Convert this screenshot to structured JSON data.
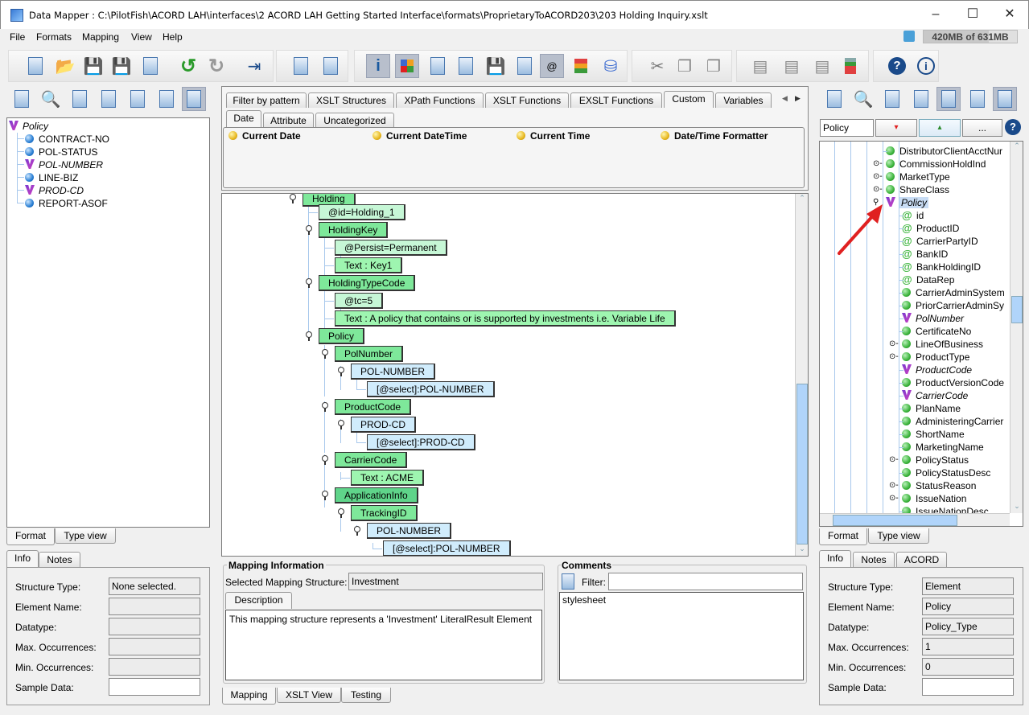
{
  "window": {
    "title": "Data Mapper : C:\\PilotFish\\ACORD LAH\\interfaces\\2 ACORD LAH Getting Started Interface\\formats\\ProprietaryToACORD203\\203 Holding Inquiry.xslt",
    "minimize": "–",
    "maximize": "☐",
    "close": "✕"
  },
  "menu": [
    "File",
    "Formats",
    "Mapping",
    "View",
    "Help"
  ],
  "memory": "420MB of 631MB",
  "toolbar": {
    "icons": [
      "new-format-icon",
      "open-icon",
      "save-icon",
      "save-as-icon",
      "export-xls-icon",
      "undo-icon",
      "redo-icon",
      "exit-icon",
      "add-mapping-icon",
      "mapping-settings-icon",
      "info-view-icon",
      "color-view-icon",
      "checklist-icon",
      "xml-source-icon",
      "save-schedule-icon",
      "xml-icon",
      "attribute-view-icon",
      "insert-text-icon",
      "database-icon",
      "cut-icon",
      "copy-icon",
      "paste-icon",
      "move-up-icon",
      "move-center-icon",
      "move-down-icon",
      "structure-color-icon",
      "help-icon",
      "about-icon"
    ]
  },
  "left_panel": {
    "root": "Policy",
    "items": [
      {
        "label": "CONTRACT-NO",
        "type": "field",
        "italic": false
      },
      {
        "label": "POL-STATUS",
        "type": "field",
        "italic": false
      },
      {
        "label": "POL-NUMBER",
        "type": "mapped",
        "italic": true
      },
      {
        "label": "LINE-BIZ",
        "type": "field",
        "italic": false
      },
      {
        "label": "PROD-CD",
        "type": "mapped",
        "italic": true
      },
      {
        "label": "REPORT-ASOF",
        "type": "field",
        "italic": false
      }
    ],
    "bottom_tabs": [
      "Format",
      "Type view"
    ],
    "info_tabs": [
      "Info",
      "Notes"
    ],
    "info": {
      "structure_type_label": "Structure Type:",
      "structure_type": "None selected.",
      "element_name_label": "Element Name:",
      "element_name": "",
      "datatype_label": "Datatype:",
      "datatype": "",
      "max_occ_label": "Max. Occurrences:",
      "max_occ": "",
      "min_occ_label": "Min. Occurrences:",
      "min_occ": "",
      "sample_label": "Sample Data:",
      "sample": ""
    }
  },
  "center": {
    "function_tabs": [
      "Filter by pattern",
      "XSLT Structures",
      "XPath Functions",
      "XSLT Functions",
      "EXSLT Functions",
      "Custom",
      "Variables"
    ],
    "active_function_tab": "Custom",
    "sub_tabs": [
      "Date",
      "Attribute",
      "Uncategorized"
    ],
    "functions": [
      "Current Date",
      "Current DateTime",
      "Current Time",
      "Date/Time Formatter"
    ],
    "mapping_nodes": [
      {
        "label": "Holding",
        "kind": "el"
      },
      {
        "label": "@id=Holding_1",
        "kind": "attr"
      },
      {
        "label": "HoldingKey",
        "kind": "el"
      },
      {
        "label": "@Persist=Permanent",
        "kind": "attr"
      },
      {
        "label": "Text : Key1",
        "kind": "txt"
      },
      {
        "label": "HoldingTypeCode",
        "kind": "el"
      },
      {
        "label": "@tc=5",
        "kind": "attr"
      },
      {
        "label": "Text : A policy that contains or is supported by investments i.e. Variable Life",
        "kind": "txt"
      },
      {
        "label": "Policy",
        "kind": "el"
      },
      {
        "label": "PolNumber",
        "kind": "el"
      },
      {
        "label": "POL-NUMBER",
        "kind": "src"
      },
      {
        "label": "[@select]:POL-NUMBER",
        "kind": "src"
      },
      {
        "label": "ProductCode",
        "kind": "el"
      },
      {
        "label": "PROD-CD",
        "kind": "src"
      },
      {
        "label": "[@select]:PROD-CD",
        "kind": "src"
      },
      {
        "label": "CarrierCode",
        "kind": "el"
      },
      {
        "label": "Text : ACME",
        "kind": "txt"
      },
      {
        "label": "ApplicationInfo",
        "kind": "elsel"
      },
      {
        "label": "TrackingID",
        "kind": "el"
      },
      {
        "label": "POL-NUMBER",
        "kind": "src"
      },
      {
        "label": "[@select]:POL-NUMBER",
        "kind": "src"
      }
    ],
    "mapping_info": {
      "title": "Mapping Information",
      "selected_label": "Selected Mapping Structure:",
      "selected_value": "Investment",
      "desc_tab": "Description",
      "description": "This mapping structure represents a 'Investment' LiteralResult Element"
    },
    "comments": {
      "title": "Comments",
      "filter_label": "Filter:",
      "filter_value": "",
      "items": [
        "stylesheet"
      ]
    },
    "bottom_tabs": [
      "Mapping",
      "XSLT View",
      "Testing"
    ]
  },
  "right_panel": {
    "search_value": "Policy",
    "more_button": "...",
    "tree": [
      {
        "label": "DistributorClientAcctNur",
        "icon": "green",
        "expander": false,
        "italic": false
      },
      {
        "label": "CommissionHoldInd",
        "icon": "green",
        "expander": true,
        "italic": false
      },
      {
        "label": "MarketType",
        "icon": "green",
        "expander": true,
        "italic": false
      },
      {
        "label": "ShareClass",
        "icon": "green",
        "expander": true,
        "italic": false
      },
      {
        "label": "Policy",
        "icon": "mapped",
        "expander": true,
        "italic": true,
        "selected": true
      },
      {
        "label": "id",
        "icon": "attr"
      },
      {
        "label": "ProductID",
        "icon": "attr"
      },
      {
        "label": "CarrierPartyID",
        "icon": "attr"
      },
      {
        "label": "BankID",
        "icon": "attr"
      },
      {
        "label": "BankHoldingID",
        "icon": "attr"
      },
      {
        "label": "DataRep",
        "icon": "attr"
      },
      {
        "label": "CarrierAdminSystem",
        "icon": "green"
      },
      {
        "label": "PriorCarrierAdminSy",
        "icon": "green"
      },
      {
        "label": "PolNumber",
        "icon": "mapped",
        "italic": true
      },
      {
        "label": "CertificateNo",
        "icon": "green"
      },
      {
        "label": "LineOfBusiness",
        "icon": "green",
        "expander": true
      },
      {
        "label": "ProductType",
        "icon": "green",
        "expander": true
      },
      {
        "label": "ProductCode",
        "icon": "mapped",
        "italic": true
      },
      {
        "label": "ProductVersionCode",
        "icon": "green"
      },
      {
        "label": "CarrierCode",
        "icon": "mapped",
        "italic": true
      },
      {
        "label": "PlanName",
        "icon": "green"
      },
      {
        "label": "AdministeringCarrier",
        "icon": "green"
      },
      {
        "label": "ShortName",
        "icon": "green"
      },
      {
        "label": "MarketingName",
        "icon": "green"
      },
      {
        "label": "PolicyStatus",
        "icon": "green",
        "expander": true
      },
      {
        "label": "PolicyStatusDesc",
        "icon": "green"
      },
      {
        "label": "StatusReason",
        "icon": "green",
        "expander": true
      },
      {
        "label": "IssueNation",
        "icon": "green",
        "expander": true
      },
      {
        "label": "IssueNationDesc",
        "icon": "green"
      }
    ],
    "bottom_tabs": [
      "Format",
      "Type view"
    ],
    "info_tabs": [
      "Info",
      "Notes",
      "ACORD"
    ],
    "info": {
      "structure_type_label": "Structure Type:",
      "structure_type": "Element",
      "element_name_label": "Element Name:",
      "element_name": "Policy",
      "datatype_label": "Datatype:",
      "datatype": "Policy_Type",
      "max_occ_label": "Max. Occurrences:",
      "max_occ": "1",
      "min_occ_label": "Min. Occurrences:",
      "min_occ": "0",
      "sample_label": "Sample Data:",
      "sample": ""
    }
  },
  "colors": {
    "element": "#7ee89a",
    "attribute": "#c6f7d6",
    "source": "#d0ecfc",
    "selection": "#b8bfcc",
    "annotation_arrow": "#e02020"
  }
}
